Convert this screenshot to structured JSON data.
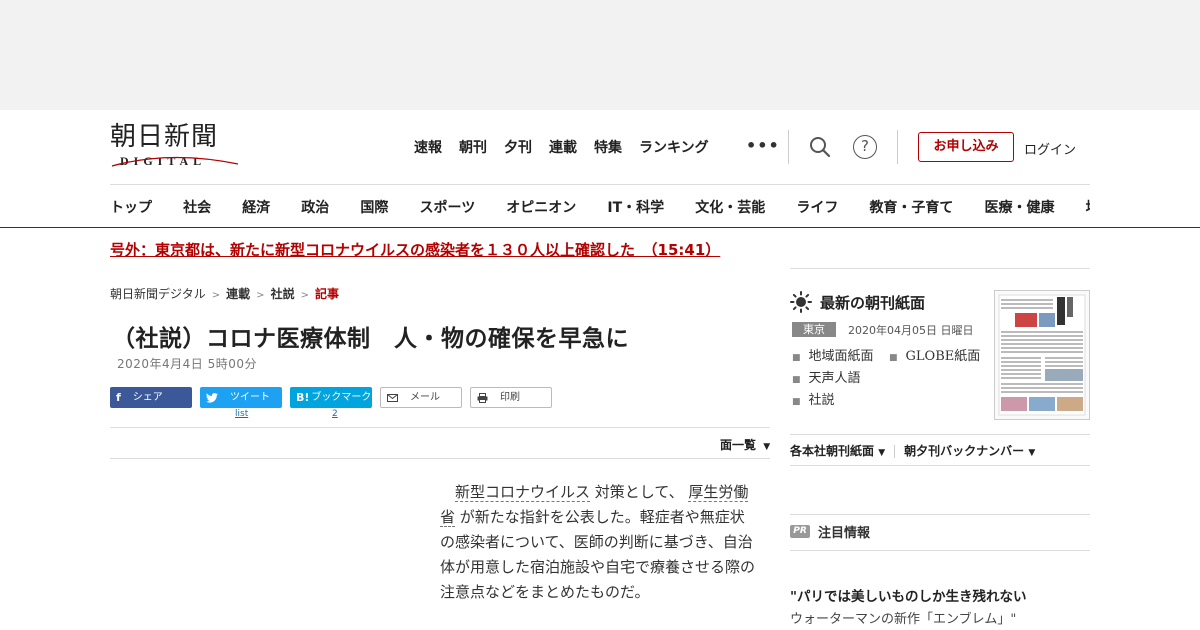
{
  "header": {
    "logo_main": "朝日新聞",
    "logo_sub": "DIGITAL",
    "nav": [
      "速報",
      "朝刊",
      "夕刊",
      "連載",
      "特集",
      "ランキング"
    ],
    "more": "•••",
    "subscribe_label": "お申し込み",
    "login_label": "ログイン"
  },
  "categories": [
    "トップ",
    "社会",
    "経済",
    "政治",
    "国際",
    "スポーツ",
    "オピニオン",
    "IT・科学",
    "文化・芸能",
    "ライフ",
    "教育・子育て",
    "医療・健康",
    "地域"
  ],
  "breaking": "号外：東京都は、新たに新型コロナウイルスの感染者を１３０人以上確認した　（15:41）",
  "breadcrumb": {
    "home": "朝日新聞デジタル",
    "level1": "連載",
    "level2": "社説",
    "current": "記事",
    "separator": ">"
  },
  "article": {
    "title": "（社説）コロナ医療体制　人・物の確保を早急に",
    "date": "2020年4月4日 5時00分",
    "page_list_label": "面一覧",
    "body_kw1": "新型コロナウイルス",
    "body_mid1": " 対策として、 ",
    "body_kw2": "厚生労働省",
    "body_rest": " が新たな指針を公表した。軽症者や無症状の感染者について、医師の判断に基づき、自治体が用意した宿泊施設や自宅で療養させる際の注意点などをまとめたものだ。"
  },
  "share": {
    "facebook": "シェア",
    "twitter": "ツイート",
    "twitter_count": "list",
    "hatena": "ブックマーク",
    "hatena_count": "2",
    "mail": "メール",
    "print": "印刷"
  },
  "sidebar": {
    "paper_title": "最新の朝刊紙面",
    "region_badge": "東京",
    "paper_date": "2020年04月05日 日曜日",
    "links": [
      "地域面紙面",
      "天声人語",
      "社説"
    ],
    "globe_link": "GLOBE紙面",
    "dropdown1": "各本社朝刊紙面",
    "dropdown2": "朝夕刊バックナンバー",
    "pr_badge": "PR",
    "pr_heading": "注目情報",
    "pr_title": "\"パリでは美しいものしか生き残れない",
    "pr_sub": "ウォーターマンの新作「エンブレム」\""
  },
  "colors": {
    "accent_red": "#b30000",
    "facebook": "#3b5998",
    "twitter": "#1da1f2",
    "hatena": "#00a4de"
  }
}
